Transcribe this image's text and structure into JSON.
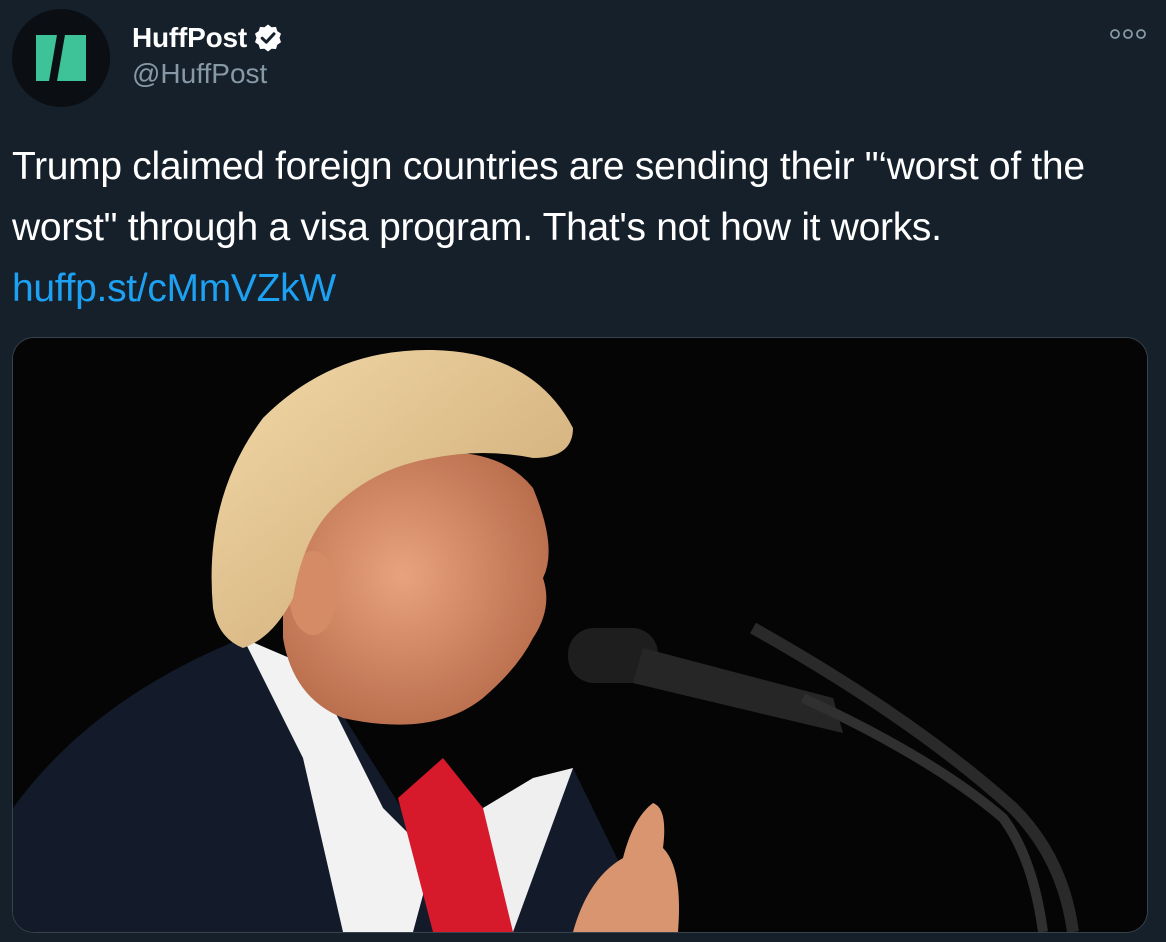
{
  "tweet": {
    "display_name": "HuffPost",
    "handle": "@HuffPost",
    "text": "Trump claimed foreign countries are sending their \"‘worst of the worst\" through a visa program. That's not how it works. ",
    "link": "huffp.st/cMmVZkW",
    "verified": true
  },
  "icons": {
    "avatar": "huffpost-logo-icon",
    "verified": "verified-badge-icon",
    "more": "more-options-icon"
  },
  "colors": {
    "background": "#15202b",
    "secondary_text": "#8899a6",
    "link": "#1da1f2",
    "brand": "#3ec298"
  }
}
